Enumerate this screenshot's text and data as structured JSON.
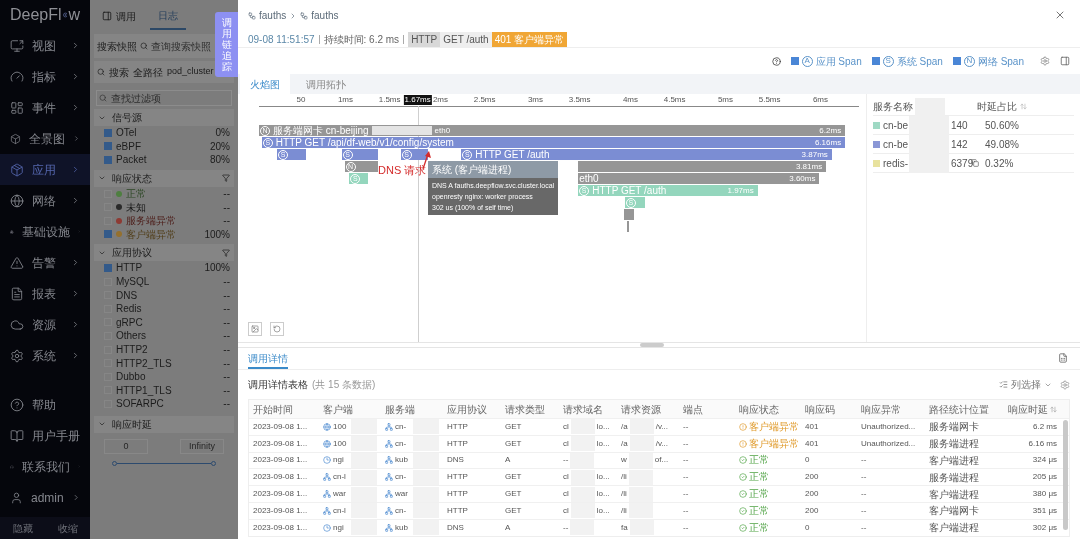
{
  "sidebar": {
    "logo": {
      "head": "DeepFl",
      "tail": "w"
    },
    "items": [
      {
        "label": "视图",
        "selected": false,
        "has_submenu": true
      },
      {
        "label": "指标",
        "selected": false,
        "has_submenu": true
      },
      {
        "label": "事件",
        "selected": false,
        "has_submenu": true
      },
      {
        "label": "全景图",
        "selected": false,
        "has_submenu": true
      },
      {
        "label": "应用",
        "selected": true,
        "has_submenu": true
      },
      {
        "label": "网络",
        "selected": false,
        "has_submenu": true
      },
      {
        "label": "基础设施",
        "selected": false,
        "has_submenu": true
      },
      {
        "label": "告警",
        "selected": false,
        "has_submenu": true
      },
      {
        "label": "报表",
        "selected": false,
        "has_submenu": true
      },
      {
        "label": "资源",
        "selected": false,
        "has_submenu": true
      },
      {
        "label": "系统",
        "selected": false,
        "has_submenu": true
      }
    ],
    "bottom_items": [
      {
        "label": "帮助",
        "has_submenu": false
      },
      {
        "label": "用户手册",
        "has_submenu": false
      },
      {
        "label": "联系我们",
        "has_submenu": true
      },
      {
        "label": "admin",
        "has_submenu": true
      }
    ],
    "footer": [
      "隐藏",
      "收缩"
    ]
  },
  "filter_panel": {
    "tabs": [
      {
        "label": "调用",
        "selected": false
      },
      {
        "label": "日志",
        "selected": true
      }
    ],
    "snapshot": {
      "label": "搜索快照",
      "placeholder": "查询搜索快照"
    },
    "search_bar": {
      "button": "搜索",
      "tags": [
        "全路径",
        "pod_cluster"
      ]
    },
    "filter_search": {
      "placeholder": "查找过滤项"
    },
    "groups": [
      {
        "title": "信号源",
        "has_filter_icon": false,
        "items": [
          {
            "label": "OTel",
            "value": "0%",
            "checked": true
          },
          {
            "label": "eBPF",
            "value": "20%",
            "checked": true
          },
          {
            "label": "Packet",
            "value": "80%",
            "checked": true
          }
        ]
      },
      {
        "title": "响应状态",
        "has_filter_icon": true,
        "items": [
          {
            "label": "正常",
            "value": "--",
            "checked": false,
            "color": "#4e7f40"
          },
          {
            "label": "未知",
            "value": "--",
            "checked": false,
            "color": "#2a2a2a"
          },
          {
            "label": "服务端异常",
            "value": "--",
            "checked": false,
            "color": "#8e3a33"
          },
          {
            "label": "客户端异常",
            "value": "100%",
            "checked": true,
            "color": "#94702e"
          }
        ]
      },
      {
        "title": "应用协议",
        "has_filter_icon": true,
        "items": [
          {
            "label": "HTTP",
            "value": "100%",
            "checked": true
          },
          {
            "label": "MySQL",
            "value": "--",
            "checked": false
          },
          {
            "label": "DNS",
            "value": "--",
            "checked": false
          },
          {
            "label": "Redis",
            "value": "--",
            "checked": false
          },
          {
            "label": "gRPC",
            "value": "--",
            "checked": false
          },
          {
            "label": "Others",
            "value": "--",
            "checked": false
          },
          {
            "label": "HTTP2",
            "value": "--",
            "checked": false
          },
          {
            "label": "HTTP2_TLS",
            "value": "--",
            "checked": false
          },
          {
            "label": "Dubbo",
            "value": "--",
            "checked": false
          },
          {
            "label": "HTTP1_TLS",
            "value": "--",
            "checked": false
          },
          {
            "label": "SOFARPC",
            "value": "--",
            "checked": false
          }
        ]
      }
    ],
    "latency": {
      "title": "响应时延",
      "min_placeholder": "0",
      "max_placeholder": "Infinity",
      "level": 1
    }
  },
  "side_tab": "调用链追踪",
  "detail": {
    "breadcrumb": [
      "fauths",
      "fauths"
    ],
    "time": "09-08 11:51:57",
    "duration": "持续时间: 6.2 ms",
    "protocol": "HTTP",
    "request": "GET /auth",
    "status_tag": "401 客户端异常",
    "span_filters": [
      {
        "badge": "A",
        "label": "应用 Span",
        "checked": true
      },
      {
        "badge": "S",
        "label": "系统 Span",
        "checked": true
      },
      {
        "badge": "N",
        "label": "网络 Span",
        "checked": true
      }
    ],
    "tabs": [
      {
        "label": "火焰图",
        "selected": true
      },
      {
        "label": "调用拓扑",
        "selected": false
      }
    ],
    "flame": {
      "ticks": [
        "50",
        "1ms",
        "1.5ms",
        "2ms",
        "2.5ms",
        "3ms",
        "3.5ms",
        "4ms",
        "4.5ms",
        "5ms",
        "5.5ms",
        "6ms"
      ],
      "cursor": "1.67ms",
      "rows": [
        [
          {
            "color": "#969696",
            "badge": "N",
            "label": "服务端网卡 cn-beijing",
            "tail": "eth0",
            "duration": "6.2ms"
          }
        ],
        [
          {
            "color": "#7b8dd3",
            "badge": "S",
            "label": "HTTP GET /api/df-web/v1/config/system",
            "duration": "6.16ms"
          }
        ],
        [
          {
            "color": "#7b8dd3",
            "badge": "S"
          },
          {
            "color": "#7b8dd3",
            "badge": "S"
          },
          {
            "color": "#7b8dd3",
            "badge": "S"
          },
          {
            "color": "#7b8dd3",
            "badge": "S",
            "label": "HTTP GET /auth",
            "duration": "3.87ms"
          }
        ],
        [
          {
            "color": "#969696",
            "badge": "N"
          },
          {
            "color": "#969696",
            "duration": "3.81ms"
          }
        ],
        [
          {
            "color": "#94d6bd",
            "badge": "S"
          },
          {
            "color": "#969696",
            "label": "eth0",
            "duration": "3.60ms"
          }
        ],
        [
          {
            "color": "#94d6bd",
            "badge": "S",
            "label": "HTTP GET /auth",
            "duration": "1.97ms"
          }
        ],
        [
          {
            "color": "#94d6bd",
            "badge": "S"
          }
        ],
        [
          {
            "color": "#969696"
          }
        ],
        [
          {
            "color": "#969696"
          }
        ]
      ],
      "tooltip": {
        "title": "系统 (客户端进程)",
        "lines": [
          "DNS A fauths.deepflow.svc.cluster.local",
          "openresty nginx: worker process",
          "302 us (100% of self time)"
        ]
      },
      "annotation": "DNS 请求"
    },
    "services": {
      "columns": [
        "服务名称",
        "时延占比"
      ],
      "rows": [
        {
          "color": "#9fd9c4",
          "name": "cn-be",
          "suffix": "140",
          "share": "50.60%",
          "copy": false
        },
        {
          "color": "#8a97d6",
          "name": "cn-be",
          "suffix": "142",
          "share": "49.08%",
          "copy": false
        },
        {
          "color": "#e8e29e",
          "name": "redis-",
          "suffix": "6379",
          "share": "0.32%",
          "copy": true
        }
      ]
    },
    "bottom_tabs": [
      {
        "label": "调用详情",
        "selected": true
      }
    ],
    "table_title": "调用详情表格",
    "table_count": "(共 15 条数据)",
    "column_picker": "列选择",
    "table": {
      "columns": [
        "开始时间",
        "客户端",
        "服务端",
        "应用协议",
        "请求类型",
        "请求域名",
        "请求资源",
        "端点",
        "响应状态",
        "响应码",
        "响应异常",
        "路径统计位置",
        "响应时延"
      ],
      "rows": [
        {
          "start": "2023-09-08 1...",
          "client": {
            "kind": "ip",
            "text": "100"
          },
          "server": {
            "kind": "pod",
            "text": "cn-"
          },
          "protocol": "HTTP",
          "type": "GET",
          "domain": {
            "head": "cl",
            "tail": "lo..."
          },
          "resource": {
            "head": "/a",
            "tail": "/v..."
          },
          "endpoint": "--",
          "status": {
            "label": "客户端异常",
            "kind": "client_error"
          },
          "code": "401",
          "exception": "Unauthorized...",
          "position": "服务端网卡",
          "latency": "6.2 ms"
        },
        {
          "start": "2023-09-08 1...",
          "client": {
            "kind": "ip",
            "text": "100"
          },
          "server": {
            "kind": "pod",
            "text": "cn-"
          },
          "protocol": "HTTP",
          "type": "GET",
          "domain": {
            "head": "cl",
            "tail": "lo..."
          },
          "resource": {
            "head": "/a",
            "tail": "/v..."
          },
          "endpoint": "--",
          "status": {
            "label": "客户端异常",
            "kind": "client_error"
          },
          "code": "401",
          "exception": "Unauthorized...",
          "position": "服务端进程",
          "latency": "6.16 ms"
        },
        {
          "start": "2023-09-08 1...",
          "client": {
            "kind": "process",
            "text": "ngi"
          },
          "server": {
            "kind": "pod",
            "text": "kub"
          },
          "protocol": "DNS",
          "type": "A",
          "domain": {
            "head": "--"
          },
          "resource": {
            "head": "w",
            "tail": "of..."
          },
          "endpoint": "--",
          "status": {
            "label": "正常",
            "kind": "ok"
          },
          "code": "0",
          "exception": "--",
          "position": "客户端进程",
          "latency": "324 μs"
        },
        {
          "start": "2023-09-08 1...",
          "client": {
            "kind": "pod",
            "text": "cn-l"
          },
          "server": {
            "kind": "pod",
            "text": "cn-"
          },
          "protocol": "HTTP",
          "type": "GET",
          "domain": {
            "head": "cl",
            "tail": "lo..."
          },
          "resource": {
            "head": "/li"
          },
          "endpoint": "--",
          "status": {
            "label": "正常",
            "kind": "ok"
          },
          "code": "200",
          "exception": "--",
          "position": "服务端进程",
          "latency": "205 μs"
        },
        {
          "start": "2023-09-08 1...",
          "client": {
            "kind": "pod",
            "text": "war"
          },
          "server": {
            "kind": "pod",
            "text": "war"
          },
          "protocol": "HTTP",
          "type": "GET",
          "domain": {
            "head": "cl",
            "tail": "lo..."
          },
          "resource": {
            "head": "/li"
          },
          "endpoint": "--",
          "status": {
            "label": "正常",
            "kind": "ok"
          },
          "code": "200",
          "exception": "--",
          "position": "客户端进程",
          "latency": "380 μs"
        },
        {
          "start": "2023-09-08 1...",
          "client": {
            "kind": "pod",
            "text": "cn-l"
          },
          "server": {
            "kind": "pod",
            "text": "cn-"
          },
          "protocol": "HTTP",
          "type": "GET",
          "domain": {
            "head": "cl",
            "tail": "lo..."
          },
          "resource": {
            "head": "/li"
          },
          "endpoint": "--",
          "status": {
            "label": "正常",
            "kind": "ok"
          },
          "code": "200",
          "exception": "--",
          "position": "客户端网卡",
          "latency": "351 μs"
        },
        {
          "start": "2023-09-08 1...",
          "client": {
            "kind": "process",
            "text": "ngi"
          },
          "server": {
            "kind": "pod",
            "text": "kub"
          },
          "protocol": "DNS",
          "type": "A",
          "domain": {
            "head": "--"
          },
          "resource": {
            "head": "fa"
          },
          "endpoint": "--",
          "status": {
            "label": "正常",
            "kind": "ok"
          },
          "code": "0",
          "exception": "--",
          "position": "客户端进程",
          "latency": "302 μs"
        }
      ]
    }
  }
}
